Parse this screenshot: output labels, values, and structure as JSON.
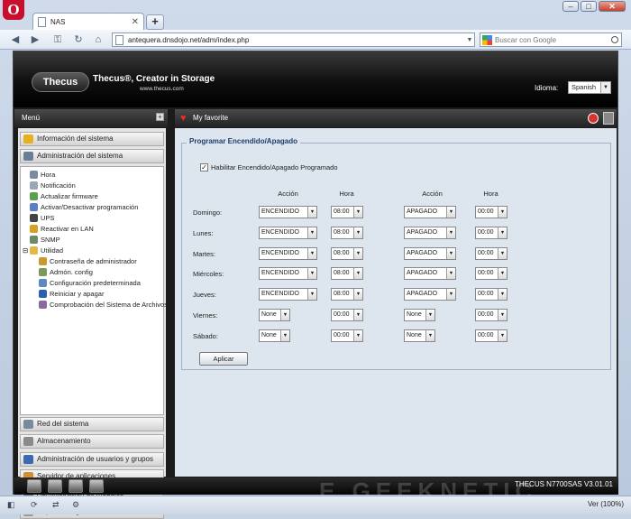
{
  "browser": {
    "tab_title": "NAS",
    "tab_close": "✕",
    "new_tab": "+",
    "url": "antequera.dnsdojo.net/adm/index.php",
    "search_placeholder": "Buscar con Google",
    "zoom_label": "Ver (100%)",
    "window_buttons": {
      "minimize": "–",
      "maximize": "□",
      "close": "✕"
    },
    "nav_icons": [
      "back-arrow-icon",
      "forward-arrow-icon",
      "key-icon",
      "reload-icon",
      "home-icon"
    ]
  },
  "banner": {
    "logo_text": "Thecus",
    "slogan": "Thecus®, Creator in Storage",
    "site_url": "www.thecus.com",
    "language_label": "Idioma:",
    "language_value": "Spanish"
  },
  "menu": {
    "title": "Menú",
    "sections_top": [
      {
        "label": "Información del sistema",
        "color": "#e8b020"
      },
      {
        "label": "Administración del sistema",
        "color": "#6a7f95"
      }
    ],
    "tree": [
      {
        "label": "Hora",
        "indent": 0,
        "color": "#7a8aa0"
      },
      {
        "label": "Notificación",
        "indent": 0,
        "color": "#9aa6b6"
      },
      {
        "label": "Actualizar firmware",
        "indent": 0,
        "color": "#5ba04a"
      },
      {
        "label": "Activar/Desactivar programación",
        "indent": 0,
        "color": "#5b7fc0"
      },
      {
        "label": "UPS",
        "indent": 0,
        "color": "#444444"
      },
      {
        "label": "Reactivar en LAN",
        "indent": 0,
        "color": "#d8a020"
      },
      {
        "label": "SNMP",
        "indent": 0,
        "color": "#6a8a6a"
      },
      {
        "label": "Utilidad",
        "indent": 0,
        "color": "#e2b84a"
      },
      {
        "label": "Contraseña de administrador",
        "indent": 1,
        "color": "#c89a30"
      },
      {
        "label": "Admón. config",
        "indent": 1,
        "color": "#7a9a5a"
      },
      {
        "label": "Configuración predeterminada",
        "indent": 1,
        "color": "#5a8ac0"
      },
      {
        "label": "Reiniciar y apagar",
        "indent": 1,
        "color": "#2a5fb0"
      },
      {
        "label": "Comprobación del Sistema de Archivos",
        "indent": 1,
        "color": "#8a6a9a"
      }
    ],
    "sections_bottom": [
      {
        "label": "Red del sistema",
        "color": "#7a8a9a"
      },
      {
        "label": "Almacenamiento",
        "color": "#8a8a8a"
      },
      {
        "label": "Administración de usuarios y grupos",
        "color": "#3a6ab0"
      },
      {
        "label": "Servidor de aplicaciones",
        "color": "#d09030"
      },
      {
        "label": "Administración de módulos",
        "color": "#6a7a8a"
      },
      {
        "label": "Copia de seguridad",
        "color": "#9a9a9a"
      }
    ]
  },
  "favorite": {
    "title": "My favorite"
  },
  "schedule": {
    "legend": "Programar Encendido/Apagado",
    "enable_label": "Habilitar Encendido/Apagado Programado",
    "enable_checked": "✓",
    "headers": {
      "action1": "Acción",
      "hour1": "Hora",
      "action2": "Acción",
      "hour2": "Hora"
    },
    "rows": [
      {
        "day": "Domingo:",
        "a1": "ENCENDIDO",
        "h1": "08:00",
        "a2": "APAGADO",
        "h2": "00:00"
      },
      {
        "day": "Lunes:",
        "a1": "ENCENDIDO",
        "h1": "08:00",
        "a2": "APAGADO",
        "h2": "00:00"
      },
      {
        "day": "Martes:",
        "a1": "ENCENDIDO",
        "h1": "08:00",
        "a2": "APAGADO",
        "h2": "00:00"
      },
      {
        "day": "Miércoles:",
        "a1": "ENCENDIDO",
        "h1": "08:00",
        "a2": "APAGADO",
        "h2": "00:00"
      },
      {
        "day": "Jueves:",
        "a1": "ENCENDIDO",
        "h1": "08:00",
        "a2": "APAGADO",
        "h2": "00:00"
      },
      {
        "day": "Viernes:",
        "a1": "None",
        "h1": "00:00",
        "a2": "None",
        "h2": "00:00"
      },
      {
        "day": "Sábado:",
        "a1": "None",
        "h1": "00:00",
        "a2": "None",
        "h2": "00:00"
      }
    ],
    "apply_label": "Aplicar"
  },
  "footer": {
    "version": "THECUS N7700SAS V3.01.01",
    "watermark": "E GEEKNETIC",
    "icons": [
      "server-icon",
      "disk-icon",
      "fan-icon",
      "network-icon"
    ]
  }
}
